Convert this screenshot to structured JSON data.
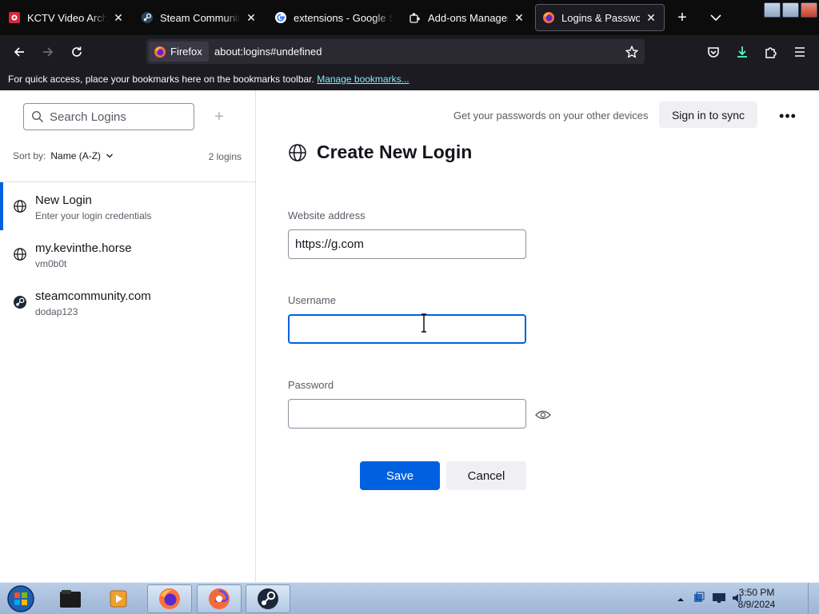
{
  "browser": {
    "tabs": [
      {
        "title": "KCTV Video Archive",
        "icon": "kctv-icon",
        "active": false
      },
      {
        "title": "Steam Community ::",
        "icon": "steam-icon",
        "active": false
      },
      {
        "title": "extensions - Google Search",
        "icon": "google-icon",
        "active": false
      },
      {
        "title": "Add-ons Manager",
        "icon": "puzzle-icon",
        "active": false
      },
      {
        "title": "Logins & Passwords",
        "icon": "firefox-icon",
        "active": true
      }
    ],
    "identity_label": "Firefox",
    "url": "about:logins#undefined",
    "bookmarks_hint": "For quick access, place your bookmarks here on the bookmarks toolbar.",
    "bookmarks_link": "Manage bookmarks..."
  },
  "sidebar": {
    "search_placeholder": "Search Logins",
    "sort_label": "Sort by:",
    "sort_value": "Name (A-Z)",
    "count": "2 logins",
    "items": [
      {
        "title": "New Login",
        "subtitle": "Enter your login credentials",
        "icon": "globe-icon",
        "selected": true
      },
      {
        "title": "my.kevinthe.horse",
        "subtitle": "vm0b0t",
        "icon": "globe-icon",
        "selected": false
      },
      {
        "title": "steamcommunity.com",
        "subtitle": "dodap123",
        "icon": "steam-icon",
        "selected": false
      }
    ]
  },
  "main": {
    "sync_text": "Get your passwords on your other devices",
    "sync_button": "Sign in to sync",
    "menu_glyph": "•••",
    "heading": "Create New Login",
    "website_label": "Website address",
    "website_value": "https://g.com",
    "username_label": "Username",
    "username_value": "",
    "password_label": "Password",
    "password_value": "",
    "save_label": "Save",
    "cancel_label": "Cancel"
  },
  "taskbar": {
    "time": "3:50 PM",
    "date": "8/9/2024"
  },
  "colors": {
    "accent": "#0061e0",
    "chrome_dark": "#1c1b22",
    "tabstrip": "#0c0c0d",
    "link": "#80ebff"
  }
}
